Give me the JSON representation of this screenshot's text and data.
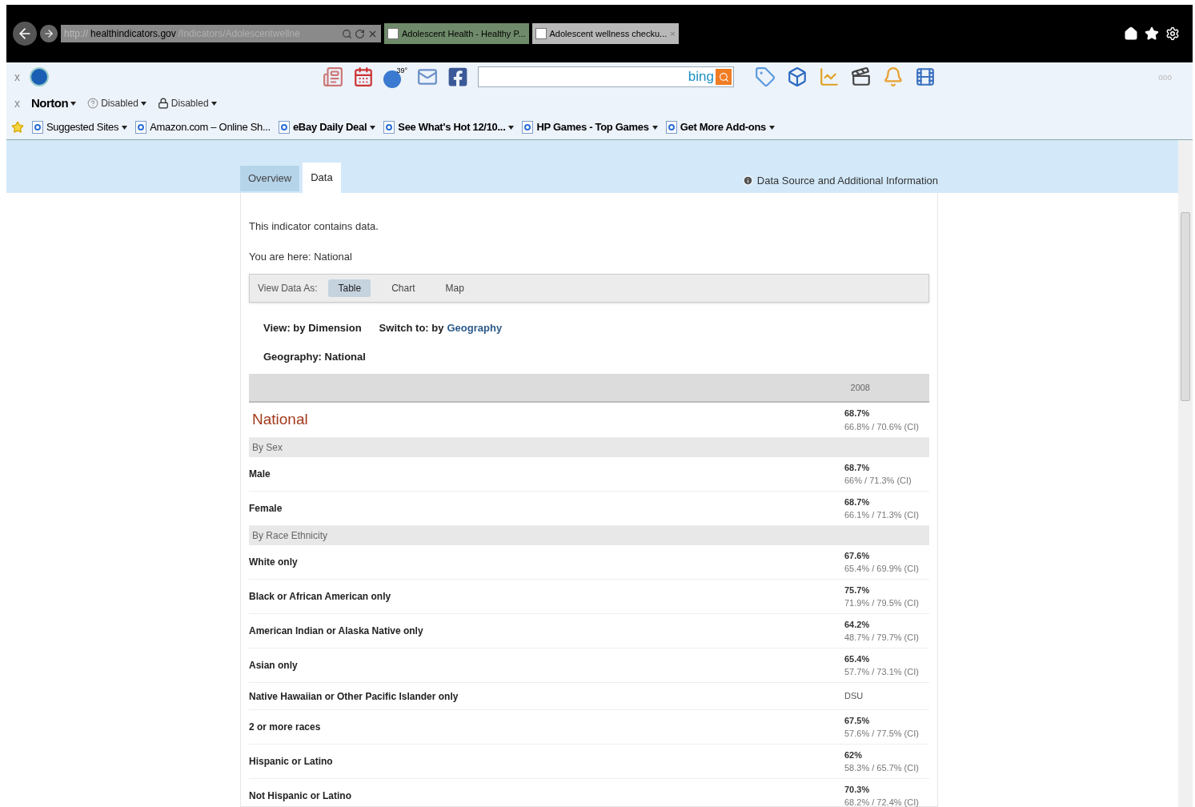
{
  "browser": {
    "address": {
      "scheme": "http://",
      "domain": "healthindicators.gov",
      "path": "/Indicators/Adolescentwellne"
    },
    "tabs": [
      {
        "title": "Adolescent Health - Healthy P...",
        "selected": false
      },
      {
        "title": "Adolescent wellness checku...",
        "selected": true,
        "close": "×"
      }
    ]
  },
  "hp_toolbar": {
    "close": "x",
    "weather": "39°",
    "search_brand": "bing",
    "dots": "ooo"
  },
  "norton_toolbar": {
    "close": "x",
    "brand": "Norton",
    "items": [
      "Disabled",
      "Disabled"
    ]
  },
  "favorites_bar": [
    {
      "label": "Suggested Sites"
    },
    {
      "label": "Amazon.com – Online Sh..."
    },
    {
      "label": "eBay Daily Deal"
    },
    {
      "label": "See What's Hot 12/10..."
    },
    {
      "label": "HP Games - Top Games"
    },
    {
      "label": "Get More Add-ons"
    }
  ],
  "page_tabs": [
    {
      "label": "Overview",
      "selected": false
    },
    {
      "label": "Data",
      "selected": true
    }
  ],
  "info_link": "Data Source and Additional Information",
  "intro": "This indicator contains data.",
  "breadcrumb": "You are here: National",
  "view_as": {
    "label": "View Data As:",
    "options": [
      {
        "label": "Table",
        "selected": true
      },
      {
        "label": "Chart",
        "selected": false
      },
      {
        "label": "Map",
        "selected": false
      }
    ]
  },
  "view": {
    "label": "View:",
    "value": "by Dimension",
    "switch_label": "Switch to:",
    "switch_prefix": "by",
    "switch_link": "Geography"
  },
  "geography": {
    "label": "Geography:",
    "value": "National"
  },
  "table": {
    "column": "2008",
    "rows": [
      {
        "kind": "total",
        "label": "National",
        "value": "68.7%",
        "ci": "66.8% / 70.6% (CI)"
      },
      {
        "kind": "group",
        "label": "By Sex"
      },
      {
        "kind": "row",
        "label": "Male",
        "value": "68.7%",
        "ci": "66% / 71.3% (CI)"
      },
      {
        "kind": "row",
        "label": "Female",
        "value": "68.7%",
        "ci": "66.1% / 71.3% (CI)"
      },
      {
        "kind": "group",
        "label": "By Race Ethnicity"
      },
      {
        "kind": "row",
        "label": "White only",
        "value": "67.6%",
        "ci": "65.4% / 69.9% (CI)"
      },
      {
        "kind": "row",
        "label": "Black or African American only",
        "value": "75.7%",
        "ci": "71.9% / 79.5% (CI)"
      },
      {
        "kind": "row",
        "label": "American Indian or Alaska Native only",
        "value": "64.2%",
        "ci": "48.7% / 79.7% (CI)"
      },
      {
        "kind": "row",
        "label": "Asian only",
        "value": "65.4%",
        "ci": "57.7% / 73.1% (CI)"
      },
      {
        "kind": "flag",
        "label": "Native Hawaiian or Other Pacific Islander only",
        "value": "DSU"
      },
      {
        "kind": "row",
        "label": "2 or more races",
        "value": "67.5%",
        "ci": "57.6% / 77.5% (CI)"
      },
      {
        "kind": "row",
        "label": "Hispanic or Latino",
        "value": "62%",
        "ci": "58.3% / 65.7% (CI)"
      },
      {
        "kind": "row",
        "label": "Not Hispanic or Latino",
        "value": "70.3%",
        "ci": "68.2% / 72.4% (CI)"
      }
    ]
  }
}
